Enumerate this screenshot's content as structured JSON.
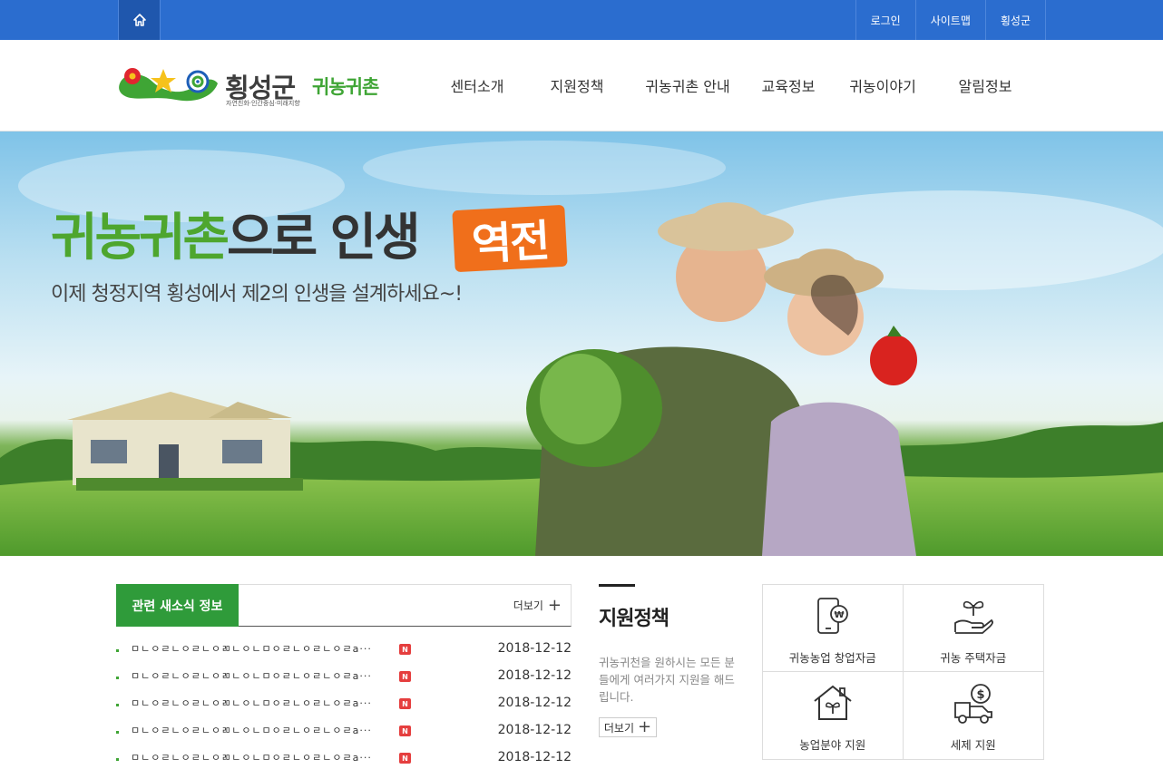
{
  "topbar": {
    "home_icon": "home-icon",
    "links": [
      "로그인",
      "사이트맵",
      "횡성군"
    ]
  },
  "header": {
    "logo_title": "횡성군",
    "logo_sub": "귀농귀촌",
    "logo_tag": "자연친화·인간중심·미래지향",
    "nav": [
      "센터소개",
      "지원정책",
      "귀농귀촌 안내",
      "교육정보",
      "귀농이야기",
      "알림정보"
    ]
  },
  "hero": {
    "headline_green": "귀농귀촌",
    "headline_dark": "으로 인생",
    "headline_badge": "역전",
    "subline": "이제 청정지역 횡성에서 제2의 인생을 설계하세요~!"
  },
  "news": {
    "tab_label": "관련 새소식 정보",
    "more_label": "더보기",
    "items": [
      {
        "title": "ㅁㄴㅇㄹㄴㅇㄹㄴㅇㄻㄴㅇㄴㅁㅇㄹㄴㅇㄹㄴㅇㄹa···",
        "badge": "N",
        "date": "2018-12-12"
      },
      {
        "title": "ㅁㄴㅇㄹㄴㅇㄹㄴㅇㄻㄴㅇㄴㅁㅇㄹㄴㅇㄹㄴㅇㄹa···",
        "badge": "N",
        "date": "2018-12-12"
      },
      {
        "title": "ㅁㄴㅇㄹㄴㅇㄹㄴㅇㄻㄴㅇㄴㅁㅇㄹㄴㅇㄹㄴㅇㄹa···",
        "badge": "N",
        "date": "2018-12-12"
      },
      {
        "title": "ㅁㄴㅇㄹㄴㅇㄹㄴㅇㄻㄴㅇㄴㅁㅇㄹㄴㅇㄹㄴㅇㄹa···",
        "badge": "N",
        "date": "2018-12-12"
      },
      {
        "title": "ㅁㄴㅇㄹㄴㅇㄹㄴㅇㄻㄴㅇㄴㅁㅇㄹㄴㅇㄹㄴㅇㄹa···",
        "badge": "N",
        "date": "2018-12-12"
      }
    ]
  },
  "policy": {
    "title": "지원정책",
    "description": "귀농귀천을 원하시는 모든 분들에게 여러가지 지원을 해드립니다.",
    "more_label": "더보기"
  },
  "support": [
    {
      "label": "귀농농업 창업자금",
      "icon": "mobile-won-icon"
    },
    {
      "label": "귀농 주택자금",
      "icon": "hand-sprout-icon"
    },
    {
      "label": "농업분야 지원",
      "icon": "house-sprout-icon"
    },
    {
      "label": "세제 지원",
      "icon": "truck-dollar-icon"
    }
  ],
  "colors": {
    "topbar": "#2b6dcf",
    "brand_green": "#3fa535",
    "news_tab": "#2f9b3a",
    "badge_orange": "#f06f1b",
    "new_badge": "#e53e3e"
  }
}
